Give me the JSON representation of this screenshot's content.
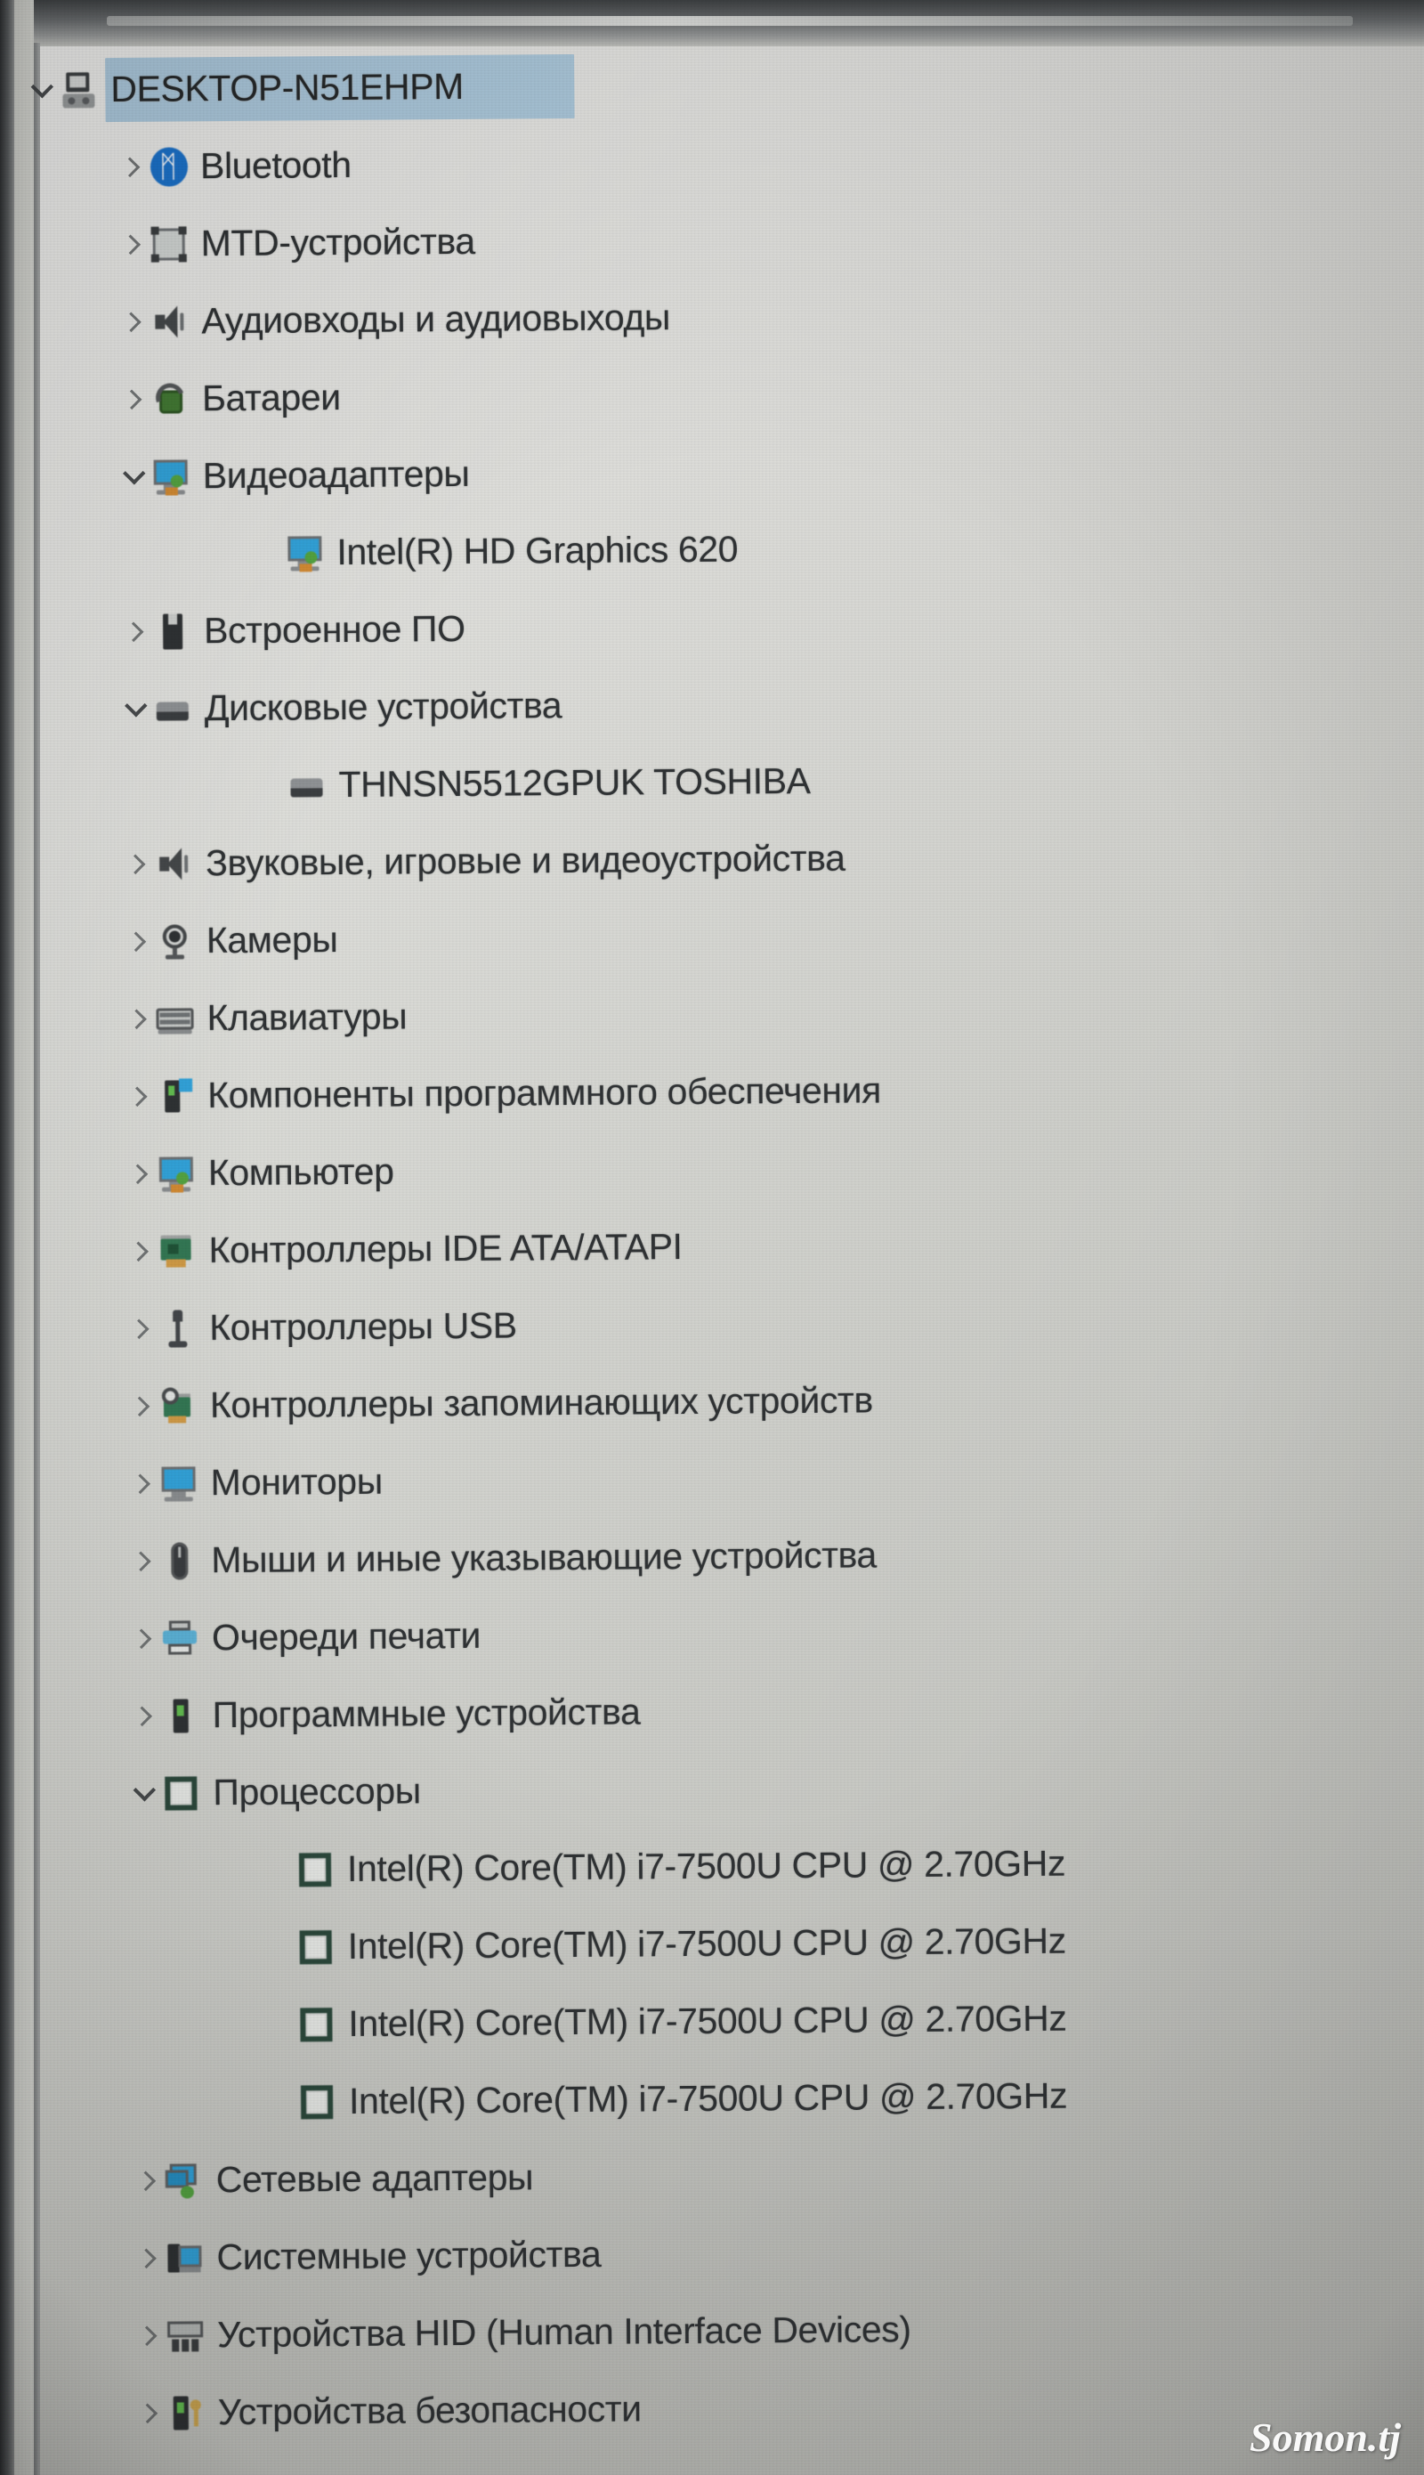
{
  "window": {
    "title_bar_present": true
  },
  "tree": {
    "root": {
      "label": "DESKTOP-N51EHPM",
      "icon": "computer-icon",
      "state": "expanded",
      "selected": true
    },
    "nodes": [
      {
        "label": "Bluetooth",
        "icon": "bluetooth-icon",
        "state": "collapsed",
        "level": 1
      },
      {
        "label": "MTD-устройства",
        "icon": "mtd-device-icon",
        "state": "collapsed",
        "level": 1
      },
      {
        "label": "Аудиовходы и аудиовыходы",
        "icon": "speaker-icon",
        "state": "collapsed",
        "level": 1
      },
      {
        "label": "Батареи",
        "icon": "battery-icon",
        "state": "collapsed",
        "level": 1
      },
      {
        "label": "Видеоадаптеры",
        "icon": "display-adapter-icon",
        "state": "expanded",
        "level": 1
      },
      {
        "label": "Intel(R) HD Graphics 620",
        "icon": "display-adapter-icon",
        "state": "leaf",
        "level": 2
      },
      {
        "label": "Встроенное ПО",
        "icon": "firmware-icon",
        "state": "collapsed",
        "level": 1
      },
      {
        "label": "Дисковые устройства",
        "icon": "disk-drive-icon",
        "state": "expanded",
        "level": 1
      },
      {
        "label": "THNSN5512GPUK TOSHIBA",
        "icon": "disk-drive-icon",
        "state": "leaf",
        "level": 2
      },
      {
        "label": "Звуковые, игровые и видеоустройства",
        "icon": "speaker-icon",
        "state": "collapsed",
        "level": 1
      },
      {
        "label": "Камеры",
        "icon": "camera-icon",
        "state": "collapsed",
        "level": 1
      },
      {
        "label": "Клавиатуры",
        "icon": "keyboard-icon",
        "state": "collapsed",
        "level": 1
      },
      {
        "label": "Компоненты программного обеспечения",
        "icon": "software-component-icon",
        "state": "collapsed",
        "level": 1
      },
      {
        "label": "Компьютер",
        "icon": "display-adapter-icon",
        "state": "collapsed",
        "level": 1
      },
      {
        "label": "Контроллеры IDE ATA/ATAPI",
        "icon": "ide-controller-icon",
        "state": "collapsed",
        "level": 1
      },
      {
        "label": "Контроллеры USB",
        "icon": "usb-icon",
        "state": "collapsed",
        "level": 1
      },
      {
        "label": "Контроллеры запоминающих устройств",
        "icon": "storage-controller-icon",
        "state": "collapsed",
        "level": 1
      },
      {
        "label": "Мониторы",
        "icon": "monitor-icon",
        "state": "collapsed",
        "level": 1
      },
      {
        "label": "Мыши и иные указывающие устройства",
        "icon": "mouse-icon",
        "state": "collapsed",
        "level": 1
      },
      {
        "label": "Очереди печати",
        "icon": "printer-icon",
        "state": "collapsed",
        "level": 1
      },
      {
        "label": "Программные устройства",
        "icon": "software-device-icon",
        "state": "collapsed",
        "level": 1
      },
      {
        "label": "Процессоры",
        "icon": "processor-icon",
        "state": "expanded",
        "level": 1
      },
      {
        "label": "Intel(R) Core(TM) i7-7500U CPU @ 2.70GHz",
        "icon": "processor-icon",
        "state": "leaf",
        "level": 2
      },
      {
        "label": "Intel(R) Core(TM) i7-7500U CPU @ 2.70GHz",
        "icon": "processor-icon",
        "state": "leaf",
        "level": 2
      },
      {
        "label": "Intel(R) Core(TM) i7-7500U CPU @ 2.70GHz",
        "icon": "processor-icon",
        "state": "leaf",
        "level": 2
      },
      {
        "label": "Intel(R) Core(TM) i7-7500U CPU @ 2.70GHz",
        "icon": "processor-icon",
        "state": "leaf",
        "level": 2
      },
      {
        "label": "Сетевые адаптеры",
        "icon": "network-adapter-icon",
        "state": "collapsed",
        "level": 1
      },
      {
        "label": "Системные устройства",
        "icon": "system-device-icon",
        "state": "collapsed",
        "level": 1
      },
      {
        "label": "Устройства HID (Human Interface Devices)",
        "icon": "hid-device-icon",
        "state": "collapsed",
        "level": 1
      },
      {
        "label": "Устройства безопасности",
        "icon": "security-device-icon",
        "state": "collapsed",
        "level": 1
      }
    ]
  },
  "watermark": {
    "text": "Somon.tj"
  },
  "colors": {
    "selection": "#a8c7dd",
    "text": "#2f3234",
    "background": "#d7d8d3",
    "bluetooth_blue": "#1573d4",
    "adapter_blue": "#2aa5e0",
    "green_accent": "#4fa63a"
  }
}
